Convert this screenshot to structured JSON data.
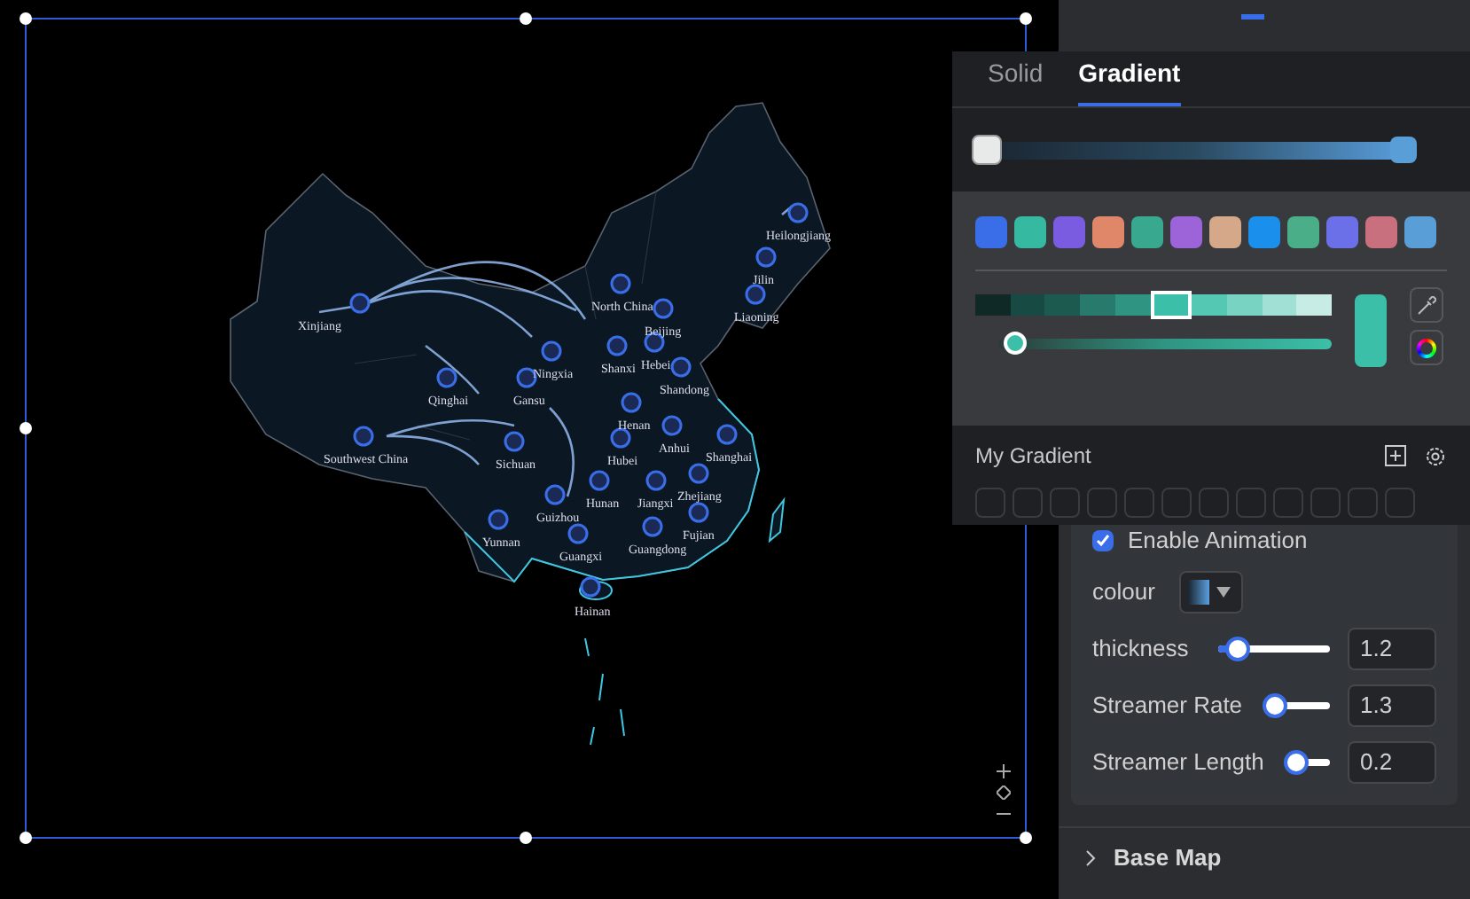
{
  "map": {
    "labels": [
      "Heilongjiang",
      "Jilin",
      "Liaoning",
      "Xinjiang",
      "North China",
      "Beijing",
      "Shanxi",
      "Hebei",
      "Shandong",
      "Ningxia",
      "Gansu",
      "Qinghai",
      "Henan",
      "Southwest China",
      "Sichuan",
      "Anhui",
      "Hubei",
      "Shanghai",
      "Zhejiang",
      "Hunan",
      "Jiangxi",
      "Guizhou",
      "Fujian",
      "Yunnan",
      "Guangxi",
      "Guangdong",
      "Hainan"
    ]
  },
  "color_picker": {
    "tabs": [
      {
        "label": "Solid",
        "selected": false
      },
      {
        "label": "Gradient",
        "selected": true
      }
    ],
    "swatches": [
      {
        "color": "#3a6ee8"
      },
      {
        "color": "#35b9a0"
      },
      {
        "color": "#7a5ce0"
      },
      {
        "color": "#e0876a"
      },
      {
        "color": "#38a88e"
      },
      {
        "color": "#9d63d8"
      },
      {
        "color": "#d4a888"
      },
      {
        "color": "#1a90ec"
      },
      {
        "color": "#4aae88"
      },
      {
        "color": "#6b6fe8"
      },
      {
        "color": "#c8707e"
      },
      {
        "color": "#5a9ed8"
      }
    ],
    "shades": [
      {
        "color": "#0f2a26",
        "selected": false
      },
      {
        "color": "#164a42",
        "selected": false
      },
      {
        "color": "#1c5a50",
        "selected": false
      },
      {
        "color": "#277a6c",
        "selected": false
      },
      {
        "color": "#2f9582",
        "selected": false
      },
      {
        "color": "#3cbfa8",
        "selected": true
      },
      {
        "color": "#55c8b4",
        "selected": false
      },
      {
        "color": "#79d3c3",
        "selected": false
      },
      {
        "color": "#a1e0d4",
        "selected": false
      },
      {
        "color": "#c6ece5",
        "selected": false
      }
    ],
    "tone_slider": {
      "level": 0.05
    },
    "preview": {
      "color": "#3cbfa8"
    },
    "my_gradient": {
      "title": "My Gradient"
    }
  },
  "settings": {
    "enable_animation": {
      "label": "Enable Animation",
      "checked": true
    },
    "colour": {
      "label": "colour"
    },
    "sliders": [
      {
        "label": "thickness",
        "level": 0.2,
        "value": "1.2"
      },
      {
        "label": "Streamer Rate",
        "level": 0.05,
        "value": "1.3"
      },
      {
        "label": "Streamer Length",
        "level": 0.1,
        "value": "0.2"
      }
    ],
    "sections": [
      {
        "label": "Base Map",
        "expanded": false
      }
    ]
  }
}
